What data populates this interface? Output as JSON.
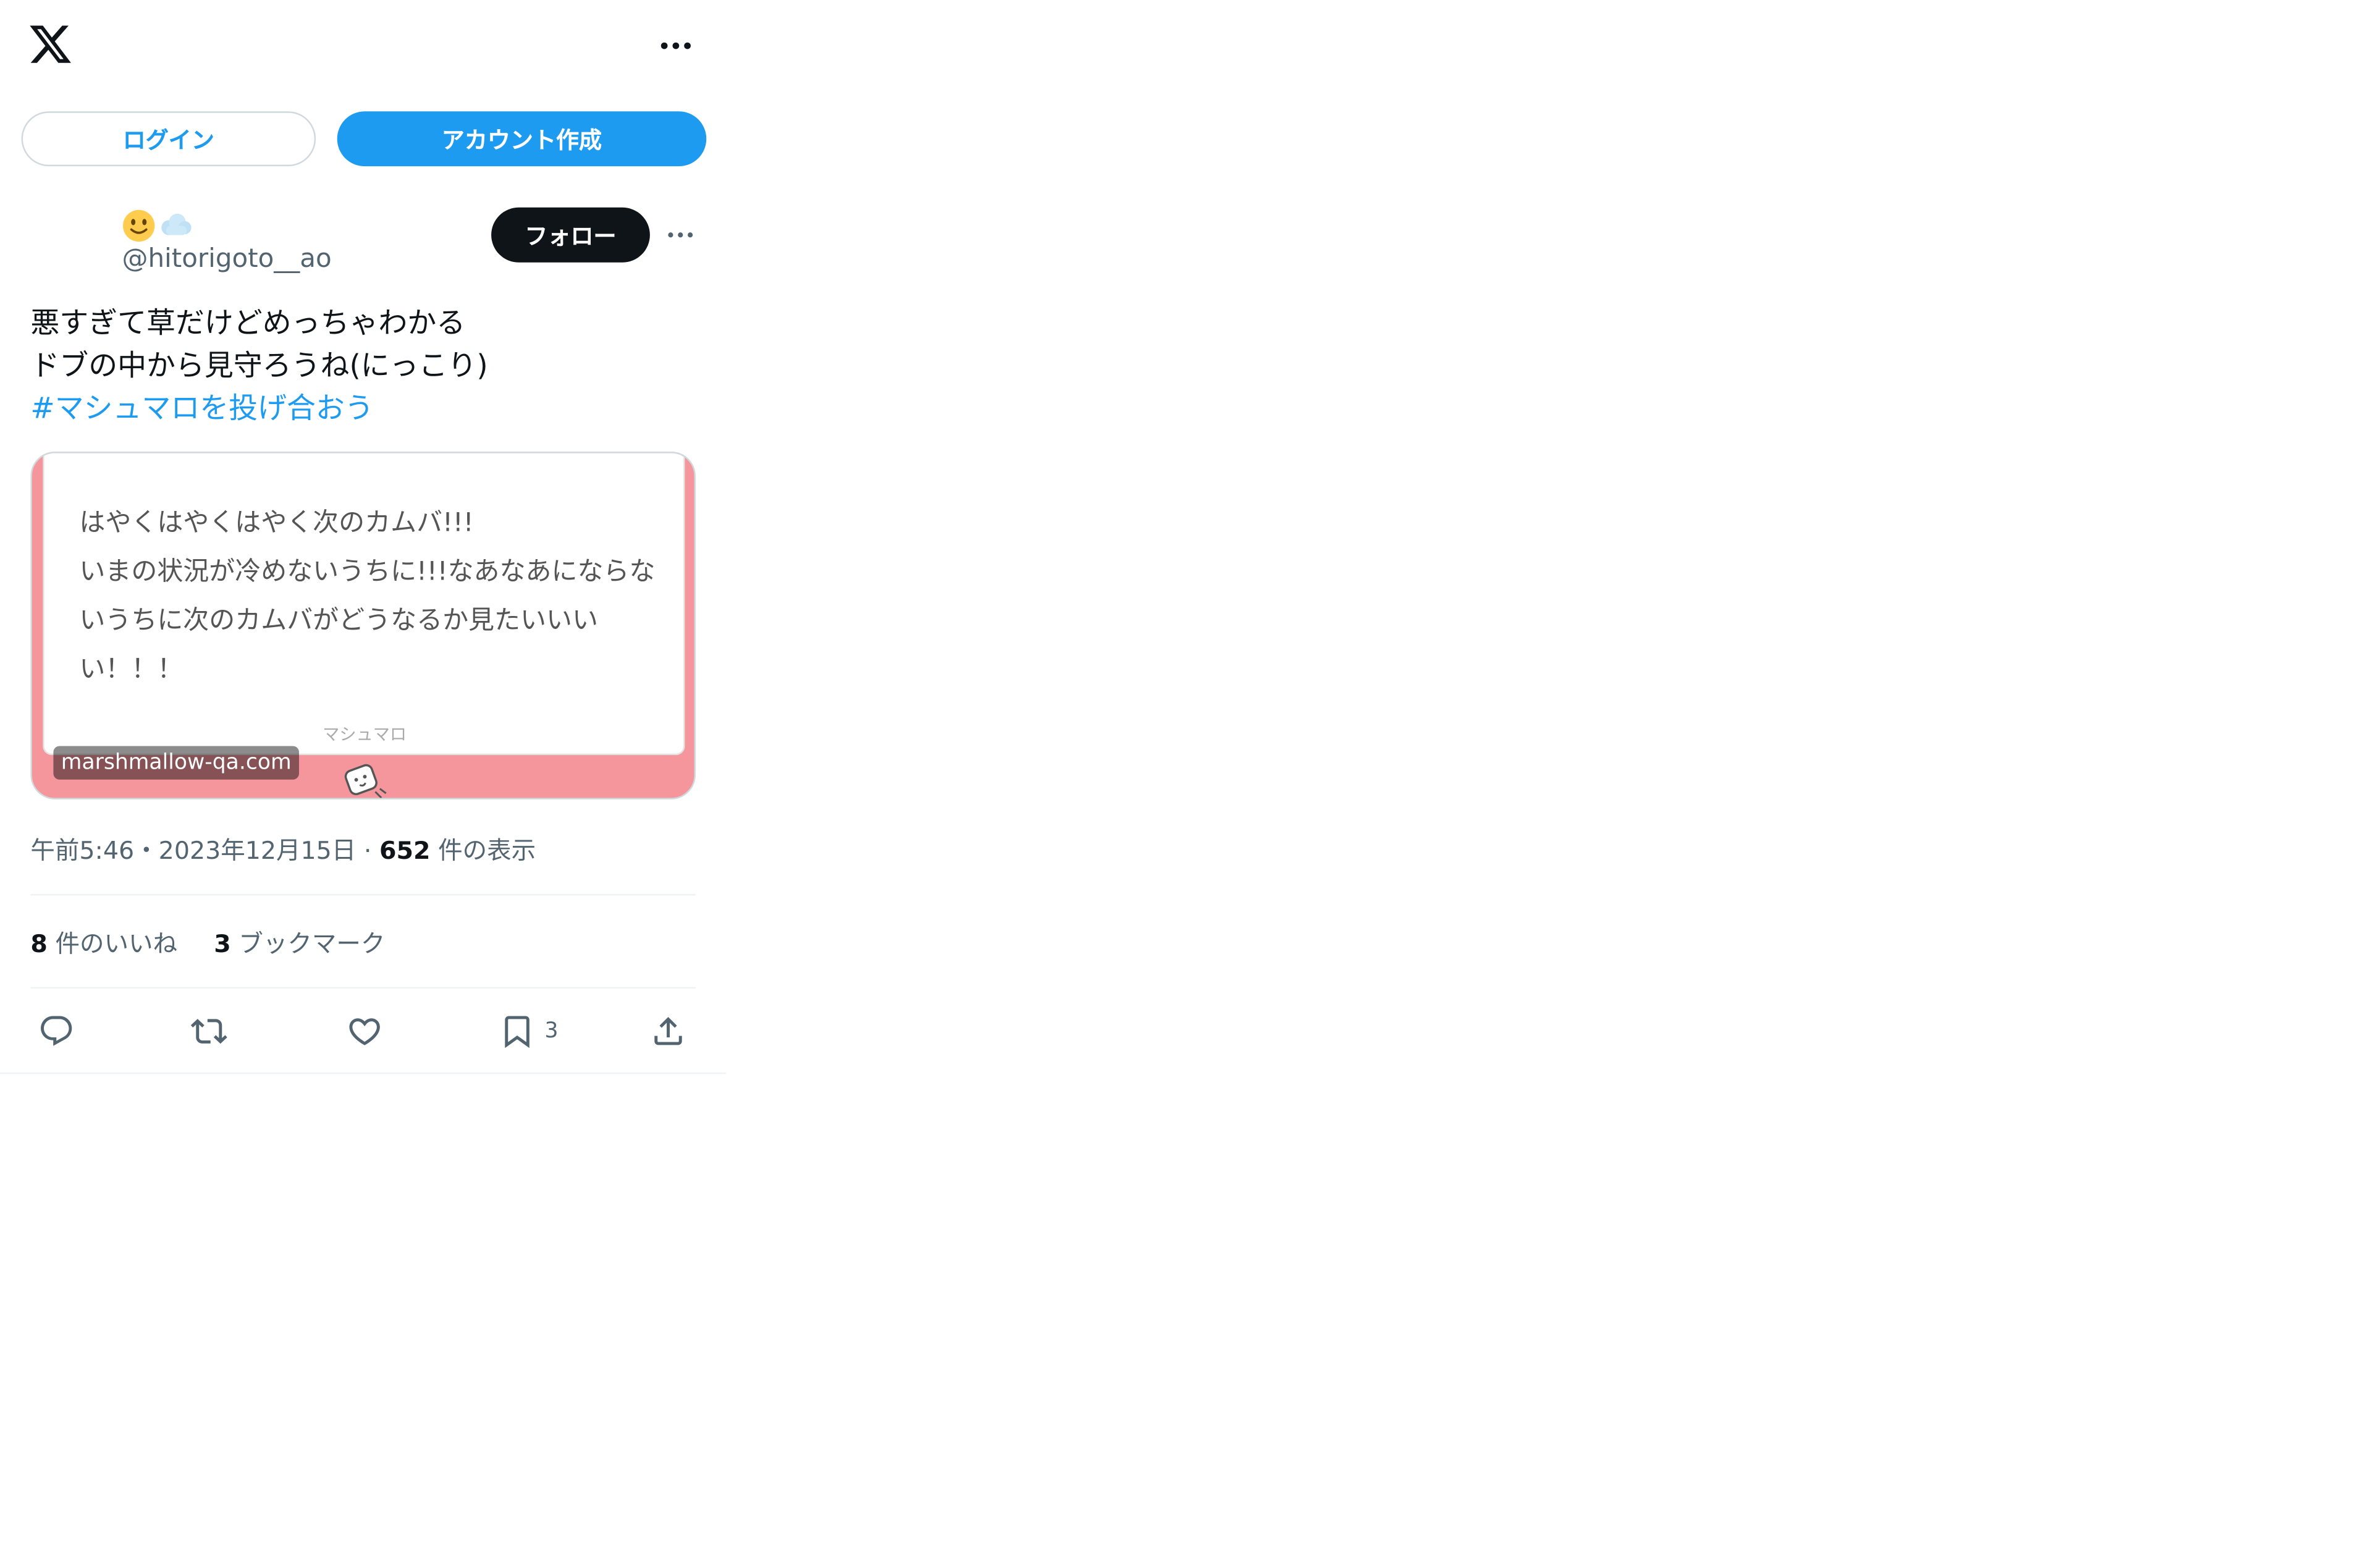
{
  "header": {
    "logo_icon": "x-logo-icon",
    "more_icon": "more-horizontal-icon"
  },
  "auth": {
    "login_label": "ログイン",
    "signup_label": "アカウント作成"
  },
  "author": {
    "display_name_emojis": [
      "slightly-smiling-face-emoji",
      "cloud-emoji"
    ],
    "handle": "@hitorigoto__ao",
    "follow_label": "フォロー"
  },
  "tweet": {
    "lines": [
      "悪すぎて草だけどめっちゃわかる",
      "ドブの中から見守ろうね(にっこり)"
    ],
    "hashtag": "#マシュマロを投げ合おう"
  },
  "card": {
    "lines": [
      "はやくはやくはやく次のカムバ!!!",
      "いまの状況が冷めないうちに!!!なあなあにならな",
      "いうちに次のカムバがどうなるか見たいいい",
      "い！！！"
    ],
    "brand": "マシュマロ",
    "domain": "marshmallow-qa.com",
    "background_color": "#f4969b"
  },
  "meta": {
    "time": "午前5:46",
    "separator": "・",
    "date": "2023年12月15日",
    "separator2": " · ",
    "views_count": "652",
    "views_label": " 件の表示"
  },
  "stats": {
    "likes_count": "8",
    "likes_label": " 件のいいね",
    "bookmarks_count": "3",
    "bookmarks_label": " ブックマーク"
  },
  "actions": {
    "reply_icon": "reply-icon",
    "retweet_icon": "retweet-icon",
    "like_icon": "heart-icon",
    "bookmark_icon": "bookmark-icon",
    "bookmark_count": "3",
    "share_icon": "share-icon"
  },
  "colors": {
    "accent": "#1d9bf0",
    "text": "#0f1419",
    "secondary": "#536471"
  }
}
